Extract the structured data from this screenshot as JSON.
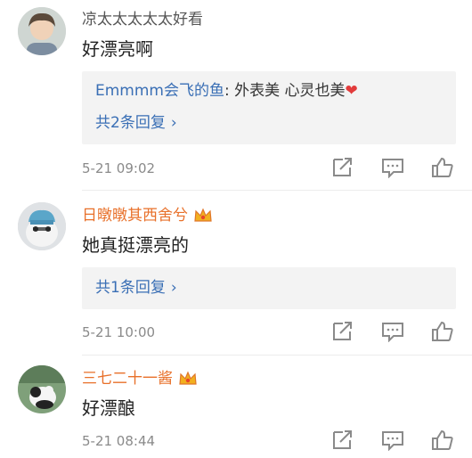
{
  "comments": [
    {
      "username": "凉太太太太太好看",
      "content": "好漂亮啊",
      "reply_preview": {
        "user": "Emmmm会飞的鱼",
        "sep": ": ",
        "text": "外表美  心灵也美",
        "heart": "❤"
      },
      "more_replies": "共2条回复",
      "time": "5-21 09:02"
    },
    {
      "username": "日暾暾其西舍兮",
      "content": "她真挺漂亮的",
      "more_replies": "共1条回复",
      "time": "5-21 10:00"
    },
    {
      "username": "三七二十一酱",
      "content": "好漂酿",
      "time": "5-21 08:44"
    }
  ],
  "icons": {
    "chevron": "›",
    "share": "share-icon",
    "comment": "comment-icon",
    "like": "like-icon",
    "badge": "crown-badge-icon"
  },
  "colors": {
    "username_vip": "#e8702a",
    "link_blue": "#3a6fb5",
    "icon_gray": "#8a8a8a"
  }
}
